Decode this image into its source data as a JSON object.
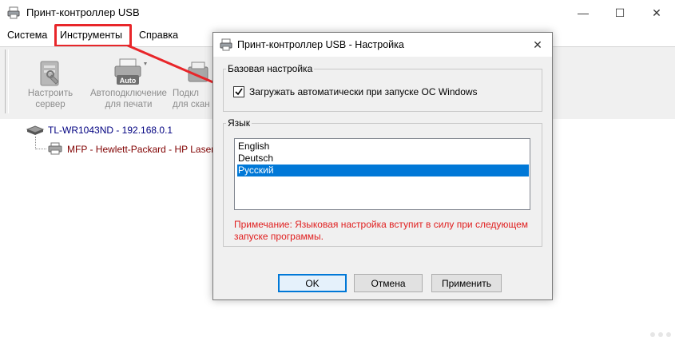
{
  "main_window": {
    "title": "Принт-контроллер USB",
    "controls": {
      "minimize": "—",
      "maximize": "☐",
      "close": "✕"
    }
  },
  "menu": {
    "items": [
      "Система",
      "Инструменты",
      "Справка"
    ],
    "highlighted_item": "Инструменты",
    "highlight_color": "#e8262a"
  },
  "toolbar": {
    "buttons": [
      {
        "line1": "Настроить",
        "line2": "сервер",
        "icon": "server-settings-icon"
      },
      {
        "line1": "Автоподключение",
        "line2": "для печати",
        "icon": "auto-printer-icon"
      },
      {
        "line1": "Подкл",
        "line2": "для скан",
        "icon": "scanner-connect-icon"
      }
    ]
  },
  "tree": {
    "device": "TL-WR1043ND - 192.168.0.1",
    "printer": "MFP - Hewlett-Packard - HP Laser"
  },
  "dialog": {
    "title": "Принт-контроллер USB - Настройка",
    "basic_group": {
      "legend": "Базовая настройка",
      "autostart_label": "Загружать автоматически при запуске ОС Windows",
      "autostart_checked": true
    },
    "language_group": {
      "legend": "Язык",
      "options": [
        "English",
        "Deutsch",
        "Русский"
      ],
      "selected": "Русский",
      "note": "Примечание: Языковая настройка вступит в силу при следующем запуске программы."
    },
    "buttons": {
      "ok": "OK",
      "cancel": "Отмена",
      "apply": "Применить"
    }
  },
  "colors": {
    "accent_selection": "#0078d7",
    "note_text": "#e01f1f",
    "annotation_red": "#e8262a",
    "tree_text": "#000080",
    "printer_text": "#800000"
  }
}
